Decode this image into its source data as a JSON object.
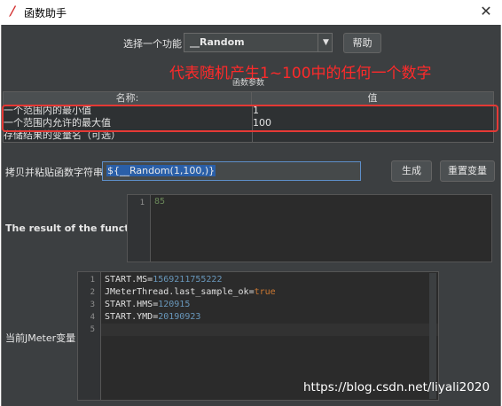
{
  "window": {
    "title": "函数助手",
    "close_glyph": "✕"
  },
  "function_select": {
    "label": "选择一个功能",
    "value": "__Random",
    "help_label": "帮助"
  },
  "annotation": "代表随机产生1~100中的任何一个数字",
  "params": {
    "caption": "函数参数",
    "headers": [
      "名称:",
      "值"
    ],
    "rows": [
      {
        "name": "一个范围内的最小值",
        "value": "1"
      },
      {
        "name": "一个范围内允许的最大值",
        "value": "100"
      },
      {
        "name": "存储结果的变量名（可选）",
        "value": ""
      }
    ]
  },
  "function_string": {
    "label": "拷贝并粘贴函数字符串",
    "value": "${__Random(1,100,)}",
    "generate_label": "生成",
    "reset_label": "重置变量"
  },
  "result": {
    "label": "The result of the function is",
    "line_numbers": [
      "1"
    ],
    "value": "85"
  },
  "variables": {
    "label": "当前JMeter变量",
    "line_numbers": [
      "1",
      "2",
      "3",
      "4",
      "5"
    ],
    "lines": [
      {
        "key": "START.MS",
        "value": "1569211755222"
      },
      {
        "key": "JMeterThread.last_sample_ok",
        "value": "true"
      },
      {
        "key": "START.HMS",
        "value": "120915"
      },
      {
        "key": "START.YMD",
        "value": "20190923"
      },
      {
        "key": "",
        "value": ""
      }
    ]
  },
  "watermark": "https://blog.csdn.net/liyali2020",
  "colors": {
    "annotation": "#ff2a2a",
    "highlight_box": "#e53935",
    "background": "#3c3f41"
  }
}
